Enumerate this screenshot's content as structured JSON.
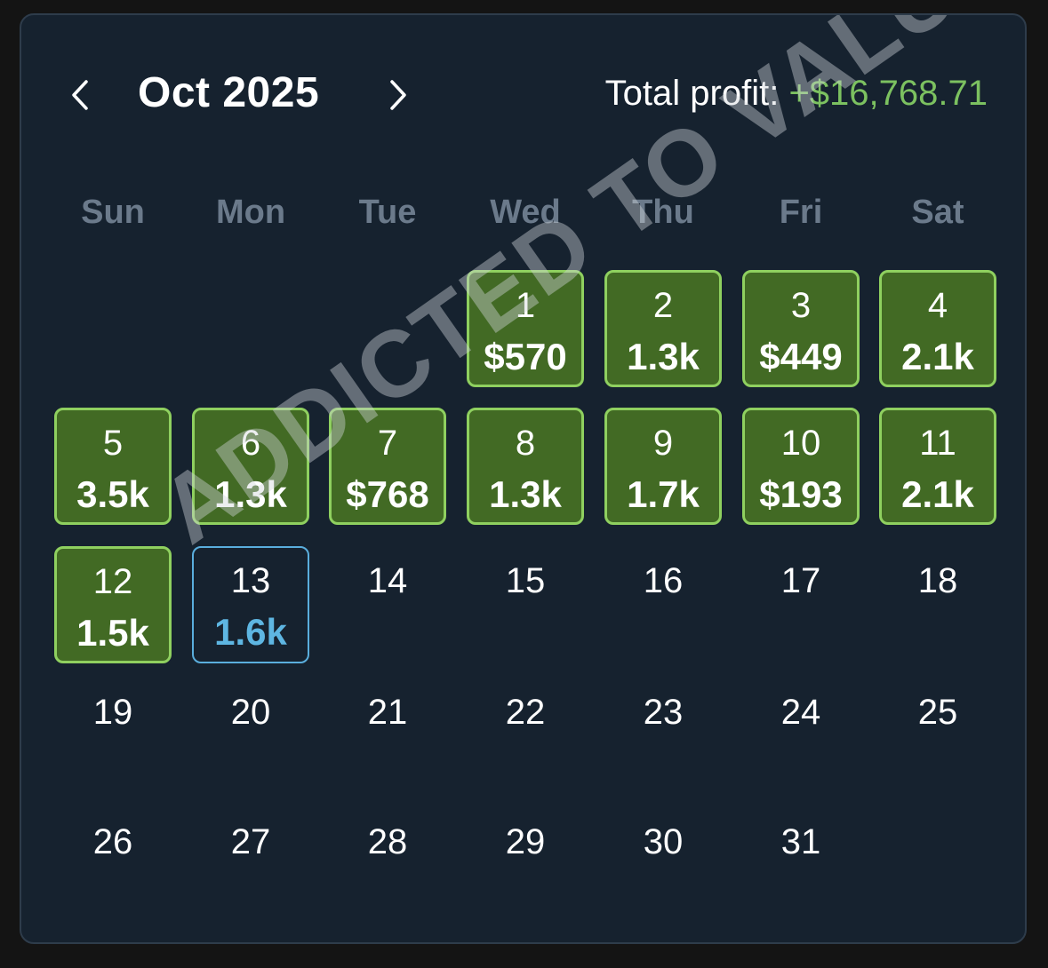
{
  "header": {
    "month_title": "Oct 2025",
    "total_label": "Total profit:",
    "total_value": "+$16,768.71",
    "prev_icon": "chevron-left-icon",
    "next_icon": "chevron-right-icon"
  },
  "weekdays": [
    "Sun",
    "Mon",
    "Tue",
    "Wed",
    "Thu",
    "Fri",
    "Sat"
  ],
  "first_weekday_index": 3,
  "days": [
    {
      "num": "1",
      "profit": "$570"
    },
    {
      "num": "2",
      "profit": "1.3k"
    },
    {
      "num": "3",
      "profit": "$449"
    },
    {
      "num": "4",
      "profit": "2.1k"
    },
    {
      "num": "5",
      "profit": "3.5k"
    },
    {
      "num": "6",
      "profit": "1.3k"
    },
    {
      "num": "7",
      "profit": "$768"
    },
    {
      "num": "8",
      "profit": "1.3k"
    },
    {
      "num": "9",
      "profit": "1.7k"
    },
    {
      "num": "10",
      "profit": "$193"
    },
    {
      "num": "11",
      "profit": "2.1k"
    },
    {
      "num": "12",
      "profit": "1.5k"
    },
    {
      "num": "13",
      "profit": "1.6k",
      "today": true
    },
    {
      "num": "14"
    },
    {
      "num": "15"
    },
    {
      "num": "16"
    },
    {
      "num": "17"
    },
    {
      "num": "18"
    },
    {
      "num": "19"
    },
    {
      "num": "20"
    },
    {
      "num": "21"
    },
    {
      "num": "22"
    },
    {
      "num": "23"
    },
    {
      "num": "24"
    },
    {
      "num": "25"
    },
    {
      "num": "26"
    },
    {
      "num": "27"
    },
    {
      "num": "28"
    },
    {
      "num": "29"
    },
    {
      "num": "30"
    },
    {
      "num": "31"
    }
  ],
  "watermark": "ADDICTED TO VALUE",
  "colors": {
    "profit_fill": "#426a24",
    "profit_border": "#8fd05f",
    "total_accent": "#7cc160",
    "today_border": "#5aaedd",
    "today_text": "#5eb6e2"
  }
}
